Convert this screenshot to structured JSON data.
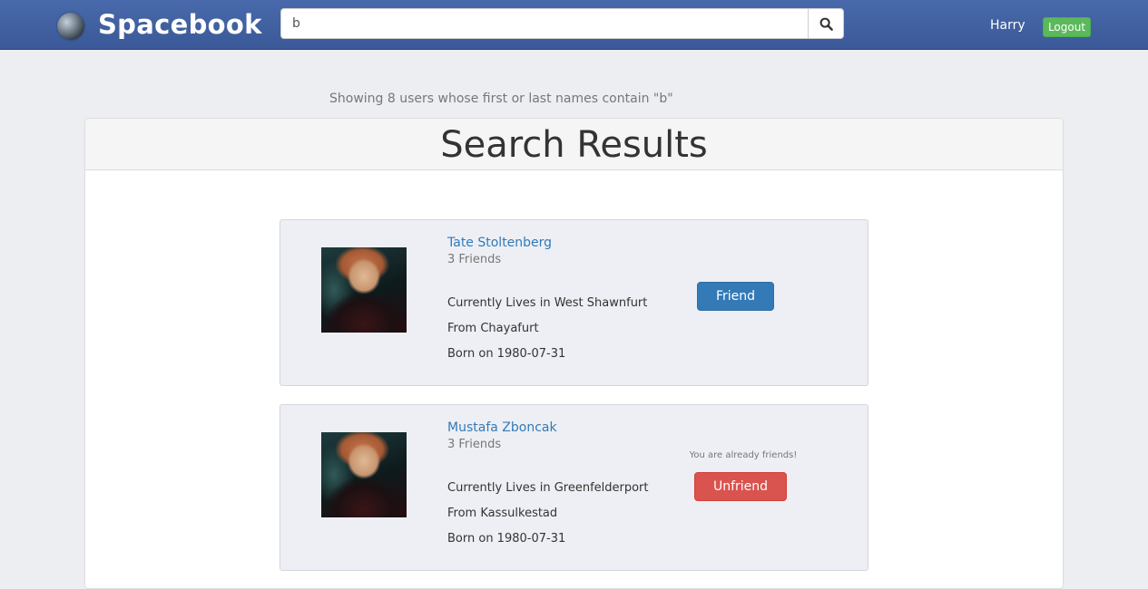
{
  "navbar": {
    "brand": "Spacebook",
    "search_value": "b",
    "user_name": "Harry",
    "logout_label": "Logout",
    "search_icon": "search-icon",
    "logo_icon": "moon-logo-icon"
  },
  "results": {
    "summary": "Showing 8 users whose first or last names contain \"b\"",
    "title": "Search Results",
    "users": [
      {
        "name": "Tate Stoltenberg",
        "friends": "3 Friends",
        "lives": "Currently Lives in West Shawnfurt",
        "from": "From Chayafurt",
        "born": "Born on 1980-07-31",
        "action_label": "Friend",
        "note": ""
      },
      {
        "name": "Mustafa Zboncak",
        "friends": "3 Friends",
        "lives": "Currently Lives in Greenfelderport",
        "from": "From Kassulkestad",
        "born": "Born on 1980-07-31",
        "action_label": "Unfriend",
        "note": "You are already friends!"
      }
    ]
  },
  "colors": {
    "navbar": "#3b5998",
    "link": "#337ab7",
    "friend_button": "#337ab7",
    "unfriend_button": "#d9534f",
    "logout_button": "#5cb85c"
  }
}
